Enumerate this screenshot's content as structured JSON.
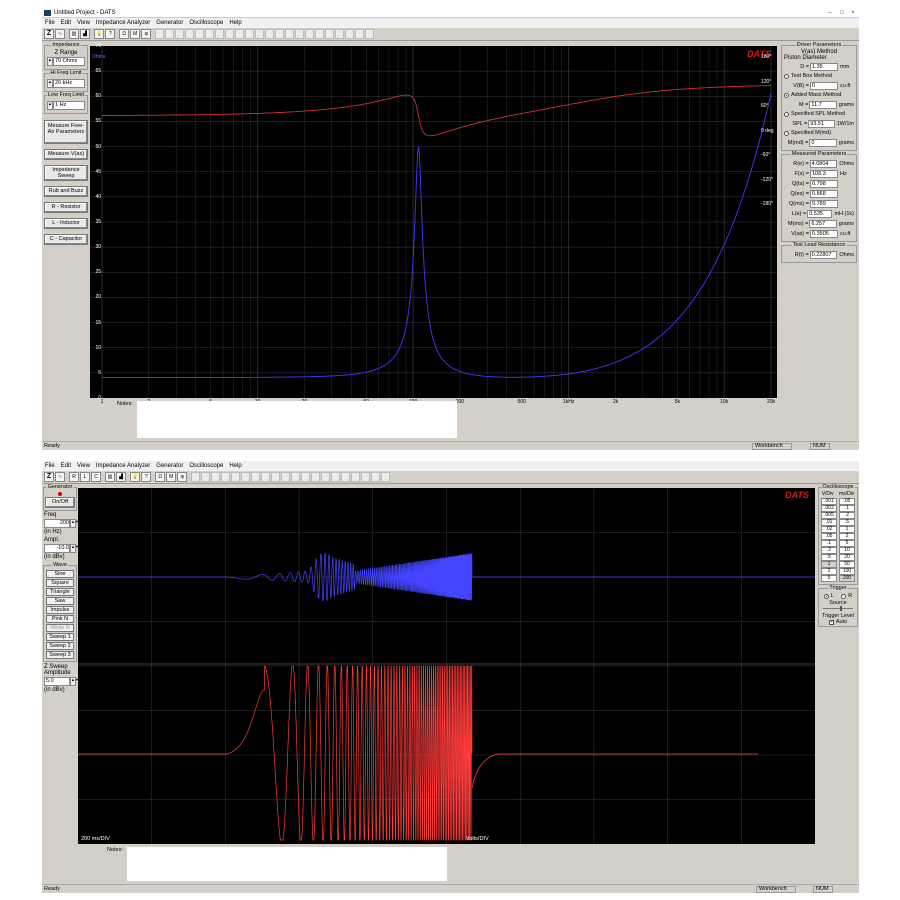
{
  "window1": {
    "title": "Untitled Project - DATS",
    "menu": [
      "File",
      "Edit",
      "View",
      "Impedance Analyzer",
      "Generator",
      "Oscilloscope",
      "Help"
    ],
    "left_panel": {
      "impedance_label": "Impedance",
      "z_range_label": "Z Range",
      "z_range_value": "70 Ohms",
      "hi_freq_label": "Hi Freq Limit",
      "hi_freq_value": "20 kHz",
      "low_freq_label": "Low Freq Limit",
      "low_freq_value": "1 Hz",
      "buttons": [
        "Measure Free-Air Parameters",
        "Measure V(as)",
        "Impedance Sweep",
        "Rub and Buzz",
        "R - Resistor",
        "L - Inductor",
        "C - Capacitor"
      ]
    },
    "graph": {
      "brand": "DATS",
      "y_unit": "Ohms",
      "y_ticks": [
        "70",
        "65",
        "60",
        "55",
        "50",
        "45",
        "40",
        "35",
        "30",
        "25",
        "20",
        "15",
        "10",
        "5",
        "0"
      ],
      "phase_ticks": [
        "180°",
        "120°",
        "60°",
        "0 deg",
        "-60°",
        "-120°",
        "-180°"
      ],
      "x_ticks": [
        "1",
        "2",
        "5",
        "10",
        "20",
        "50",
        "100",
        "200",
        "500",
        "1kHz",
        "2k",
        "5k",
        "10k",
        "20k"
      ]
    },
    "notes_label": "Notes:",
    "right_panel": {
      "driver_params_label": "Driver Parameters",
      "vas_method_label": "V(as) Method",
      "piston_diameter_label": "Piston Diameter",
      "d_label": "D =",
      "d_value": "1.35",
      "d_unit": "mm",
      "test_box_label": "Test Box Method",
      "vb_label": "V(B) =",
      "vb_value": "0",
      "vb_unit": "cu.ft",
      "added_mass_label": "Added Mass Method",
      "m_label": "M =",
      "m_value": "11.7",
      "m_unit": "grams",
      "specified_spl_label": "Specified SPL Method",
      "spl_label": "SPL =",
      "spl_value": "93.51",
      "spl_unit": "1W/1m",
      "specified_mmd_label": "Specified M(md)",
      "mmd_label": "M(md) =",
      "mmd_value": "0",
      "mmd_unit": "grams",
      "measured_params_label": "Measured Parameters",
      "measured": [
        {
          "k": "R(e) =",
          "v": "4.0804",
          "u": "Ohms"
        },
        {
          "k": "F(s) =",
          "v": "108.3",
          "u": "Hz"
        },
        {
          "k": "Q(ts) =",
          "v": "0.798",
          "u": ""
        },
        {
          "k": "Q(es) =",
          "v": "0.868",
          "u": ""
        },
        {
          "k": "Q(ms) =",
          "v": "9.789",
          "u": ""
        },
        {
          "k": "L(e) =",
          "v": "0.535",
          "u": "mH (1k)"
        },
        {
          "k": "M(ms) =",
          "v": "6.257",
          "u": "grams"
        },
        {
          "k": "V(as) =",
          "v": "0.3505",
          "u": "cu.ft"
        }
      ],
      "test_lead_label": "Test Lead Resistance",
      "rt_label": "R(t) =",
      "rt_value": "0.22807",
      "rt_unit": "Ohms"
    },
    "status": {
      "text": "Ready",
      "workbench": "Workbench",
      "num": "NUM"
    }
  },
  "window2": {
    "menu": [
      "File",
      "Edit",
      "View",
      "Impedance Analyzer",
      "Generator",
      "Oscilloscope",
      "Help"
    ],
    "left_panel": {
      "generator_label": "Generator",
      "onoff_label": "On/Off",
      "freq_label": "Freq",
      "freq_value": "200",
      "freq_unit": "(in Hz)",
      "ampl_label": "Ampl.",
      "ampl_value": "-10.0",
      "ampl_unit": "(in dBv)",
      "wave_label": "Wave",
      "waves": [
        "Sine",
        "Square",
        "Triangle",
        "Saw",
        "Impulse",
        "Pink N",
        "White N",
        "Sweep 1",
        "Sweep 2",
        "Sweep 3"
      ],
      "zsweep_label": "Z Sweep Amplitude",
      "zsweep_value": "5.0",
      "zsweep_unit": "(in dBv)"
    },
    "scope": {
      "brand": "DATS",
      "time_label": "200  ms/DIV",
      "volts_label": "Volts/DIV"
    },
    "notes_label": "Notes:",
    "right_panel": {
      "oscilloscope_label": "Oscilloscope",
      "vdiv_label": "V/Div",
      "msdiv_label": "ms/Div",
      "vdiv": [
        ".001",
        ".002",
        ".005",
        ".01",
        ".02",
        ".05",
        ".1",
        ".2",
        ".5",
        "1",
        "2",
        "5"
      ],
      "msdiv": [
        ".05",
        ".1",
        ".2",
        ".5",
        "1",
        "2",
        "5",
        "10",
        "20",
        "50",
        "100",
        "200"
      ],
      "trigger_label": "Trigger",
      "trig_l": "L",
      "trig_r": "R",
      "source_label": "Source",
      "trigger_level_label": "Trigger Level",
      "auto_label": "Auto"
    },
    "status": {
      "text": "Ready",
      "workbench": "Workbench",
      "num": "NUM"
    }
  },
  "colors": {
    "impedance": "#3b3bff",
    "phase": "#d03030",
    "scope_top": "#4444ff",
    "scope_bottom": "#ff3b3b",
    "grid": "#3a3a3a",
    "brand": "#d81b1b"
  }
}
